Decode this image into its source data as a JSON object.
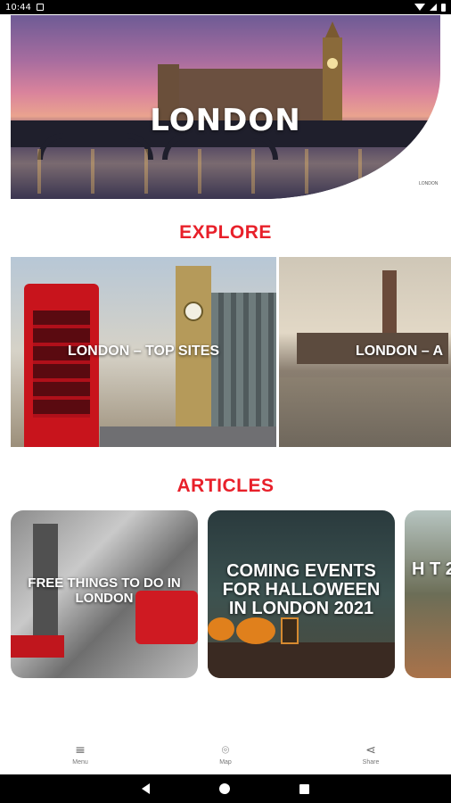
{
  "status_bar": {
    "time": "10:44"
  },
  "hero": {
    "title": "LONDON",
    "logo_text": "LONDON"
  },
  "explore": {
    "title": "EXPLORE",
    "cards": [
      {
        "label": "LONDON – TOP SITES"
      },
      {
        "label": "LONDON – A"
      }
    ]
  },
  "articles": {
    "title": "ARTICLES",
    "cards": [
      {
        "label": "FREE THINGS TO DO IN LONDON"
      },
      {
        "label": "COMING EVENTS FOR HALLOWEEN IN LONDON 2021"
      },
      {
        "label": "H T 2"
      }
    ]
  },
  "bottom_nav": {
    "items": [
      {
        "label": "Menu",
        "icon": "menu-icon"
      },
      {
        "label": "Map",
        "icon": "map-pin-icon"
      },
      {
        "label": "Share",
        "icon": "share-icon"
      }
    ]
  },
  "colors": {
    "accent": "#e8202a"
  }
}
